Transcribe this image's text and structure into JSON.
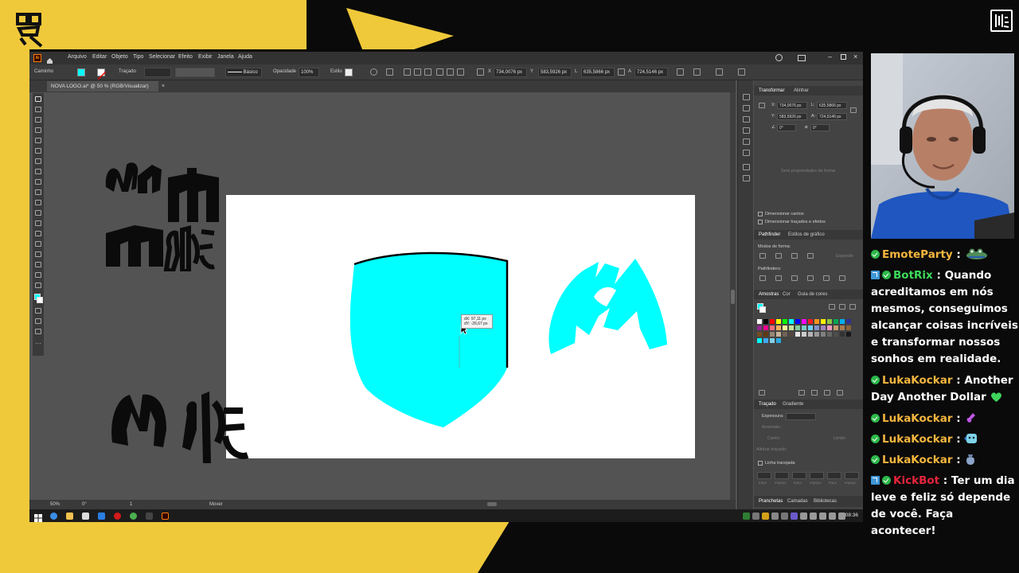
{
  "stream": {
    "yellow": "#f0c93a",
    "black": "#0a0a0a"
  },
  "illustrator": {
    "menu": [
      "Arquivo",
      "Editar",
      "Objeto",
      "Tipo",
      "Selecionar",
      "Efeito",
      "Exibir",
      "Janela",
      "Ajuda"
    ],
    "control": {
      "object_type": "Caminho",
      "stroke_label": "Traçado",
      "stroke_style": "Básico",
      "opacity_label": "Opacidade",
      "opacity_value": "100%",
      "style_label": "Estilo",
      "x_label": "X",
      "x_value": "734,0076 px",
      "y_label": "Y",
      "y_value": "583,5926 px",
      "w_label": "L",
      "w_value": "635,5866 px",
      "h_label": "A",
      "h_value": "724,5146 px"
    },
    "doc_tab": "NOVA LOGO.ai* @ 50 % (RGB/Visualizar)",
    "doc_tab_close": "×",
    "tooltip": {
      "dx": "dX: 97,11 px",
      "dy": "dY: -26,67 px"
    },
    "status": {
      "zoom": "50%",
      "rotation": "0°",
      "artboard": "1",
      "tool": "Mover"
    },
    "fill_color": "#00ffff",
    "panels": {
      "transform_tab": "Transformar",
      "align_tab": "Alinhar",
      "x": "734,0076 px",
      "y": "583,5926 px",
      "w": "635,5866 px",
      "h": "724,5146 px",
      "angle": "0°",
      "shear": "0°",
      "no_shape": "Sem propriedades de forma",
      "scale_corners": "Dimensionar cantos",
      "scale_strokes": "Dimensionar traçados e efeitos",
      "pathfinder_tab": "Pathfinder",
      "graphic_styles_tab": "Estilos de gráfico",
      "shape_modes": "Modos de forma:",
      "expand": "Expandir",
      "pathfinders": "Pathfinders:",
      "swatches_tab": "Amostras",
      "color_tab": "Cor",
      "color_guide_tab": "Guia de cores",
      "stroke_tab": "Traçado",
      "gradient_tab": "Gradiente",
      "weight_label": "Espessura:",
      "cap_label": "Arremate:",
      "corner_label": "Canto:",
      "limit_label": "Limite:",
      "align_stroke": "Alinhar traçado:",
      "dashed": "Linha tracejada",
      "dash_labels": [
        "traço",
        "espaço",
        "traço",
        "espaço",
        "traço",
        "espaço"
      ],
      "bottom_tabs": [
        "Pranchetas",
        "Camadas",
        "Bibliotecas"
      ]
    }
  },
  "taskbar": {
    "time": "08:36"
  },
  "chat": [
    {
      "user": "EmoteParty",
      "color": "#f4b63f",
      "badges": [
        "check"
      ],
      "text": "",
      "emote": "frog"
    },
    {
      "user": "BotRix",
      "color": "#3ddc5c",
      "badges": [
        "bot",
        "check"
      ],
      "text": "Quando acreditamos em nós mesmos, conseguimos alcançar coisas incríveis e transformar nossos sonhos em realidade."
    },
    {
      "user": "LukaKockar",
      "color": "#f4b63f",
      "badges": [
        "check"
      ],
      "text": "Another Day Another Dollar",
      "emote": "green-heart"
    },
    {
      "user": "LukaKockar",
      "color": "#f4b63f",
      "badges": [
        "check"
      ],
      "text": "",
      "emote": "purple-guitar"
    },
    {
      "user": "LukaKockar",
      "color": "#f4b63f",
      "badges": [
        "check"
      ],
      "text": "",
      "emote": "blue-face"
    },
    {
      "user": "LukaKockar",
      "color": "#f4b63f",
      "badges": [
        "check"
      ],
      "text": "",
      "emote": "bag"
    },
    {
      "user": "KickBot",
      "color": "#e6243b",
      "badges": [
        "bot",
        "check"
      ],
      "text": "Ter um dia leve e feliz só depende de você. Faça acontecer!"
    }
  ]
}
